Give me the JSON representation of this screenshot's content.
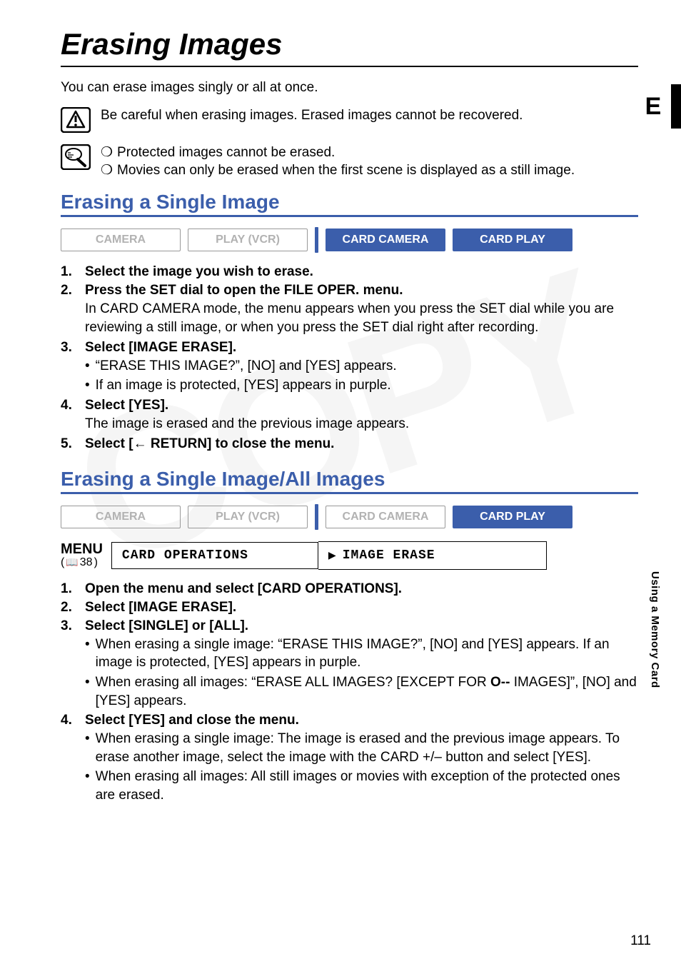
{
  "page": {
    "title": "Erasing Images",
    "intro": "You can erase images singly or all at once.",
    "lang_tab": "E",
    "side_label": "Using a Memory Card",
    "page_number": "111"
  },
  "warning": "Be careful when erasing images. Erased images cannot be recovered.",
  "notes": [
    "Protected images cannot be erased.",
    "Movies can only be erased when the first scene is displayed as a still image."
  ],
  "section1": {
    "heading": "Erasing a Single Image",
    "modes": {
      "camera": "CAMERA",
      "play_vcr": "PLAY (VCR)",
      "card_camera": "CARD CAMERA",
      "card_play": "CARD PLAY"
    },
    "steps": {
      "s1": {
        "num": "1.",
        "title": "Select the image you wish to erase."
      },
      "s2": {
        "num": "2.",
        "title": "Press the SET dial to open the FILE OPER. menu.",
        "detail": "In CARD CAMERA mode, the menu appears when you press the SET dial while you are reviewing a still image, or when you press the SET dial right after recording."
      },
      "s3": {
        "num": "3.",
        "title": "Select [IMAGE ERASE].",
        "b1": "“ERASE THIS IMAGE?”, [NO] and [YES] appears.",
        "b2": "If an image is protected, [YES] appears in purple."
      },
      "s4": {
        "num": "4.",
        "title": "Select [YES].",
        "detail": "The image is erased and the previous image appears."
      },
      "s5": {
        "num": "5.",
        "title_pre": "Select [",
        "title_post": " RETURN] to close the menu."
      }
    }
  },
  "section2": {
    "heading": "Erasing a Single Image/All Images",
    "modes": {
      "camera": "CAMERA",
      "play_vcr": "PLAY (VCR)",
      "card_camera": "CARD CAMERA",
      "card_play": "CARD PLAY"
    },
    "menu_path": {
      "label": "MENU",
      "ref": "38",
      "box1": "CARD OPERATIONS",
      "box2": "IMAGE ERASE"
    },
    "steps": {
      "s1": {
        "num": "1.",
        "title": "Open the menu and select [CARD OPERATIONS]."
      },
      "s2": {
        "num": "2.",
        "title": "Select [IMAGE ERASE]."
      },
      "s3": {
        "num": "3.",
        "title": "Select [SINGLE] or [ALL].",
        "b1": "When erasing a single image: “ERASE THIS IMAGE?”, [NO] and [YES] appears. If an image is protected, [YES] appears in purple.",
        "b2_pre": "When erasing all images: “ERASE ALL IMAGES? [EXCEPT FOR ",
        "b2_post": " IMAGES]”, [NO] and [YES] appears."
      },
      "s4": {
        "num": "4.",
        "title": "Select [YES] and close the menu.",
        "b1": "When erasing a single image: The image is erased and the previous image appears. To erase another image, select the image with the CARD +/– button and select [YES].",
        "b2": "When erasing all images: All still images or movies with exception of the protected ones are erased."
      }
    }
  }
}
